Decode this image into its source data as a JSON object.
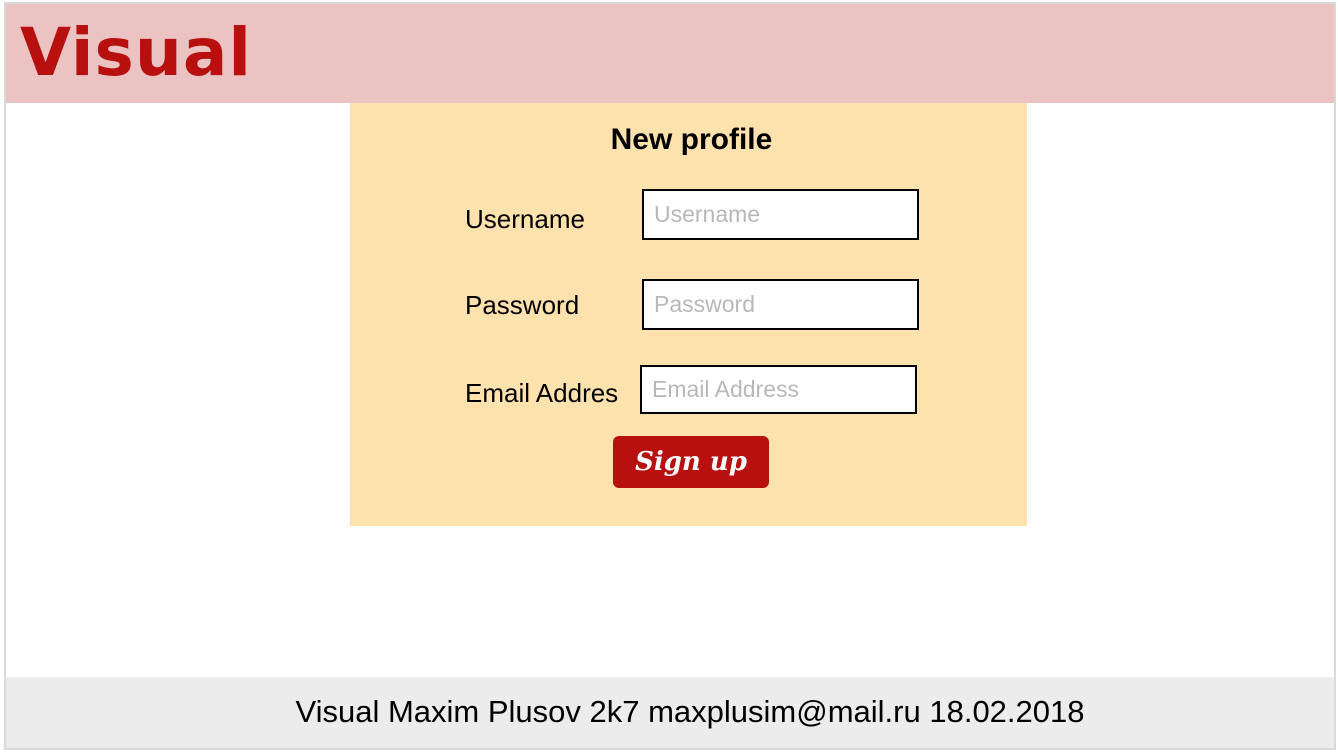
{
  "header": {
    "logo_text": "Visual"
  },
  "form": {
    "title": "New profile",
    "fields": [
      {
        "label": "Username",
        "value": "",
        "placeholder": "Username"
      },
      {
        "label": "Password",
        "value": "",
        "placeholder": "Password"
      },
      {
        "label": "Email Addres",
        "value": "",
        "placeholder": "Email Address"
      }
    ],
    "submit_label": "Sign up"
  },
  "footer": {
    "text": "Visual Maxim Plusov 2k7 maxplusim@mail.ru 18.02.2018"
  },
  "colors": {
    "header_bg": "#ebc3c3",
    "brand": "#b80f0f",
    "card_bg": "#fee2ae",
    "footer_bg": "#ececec"
  }
}
